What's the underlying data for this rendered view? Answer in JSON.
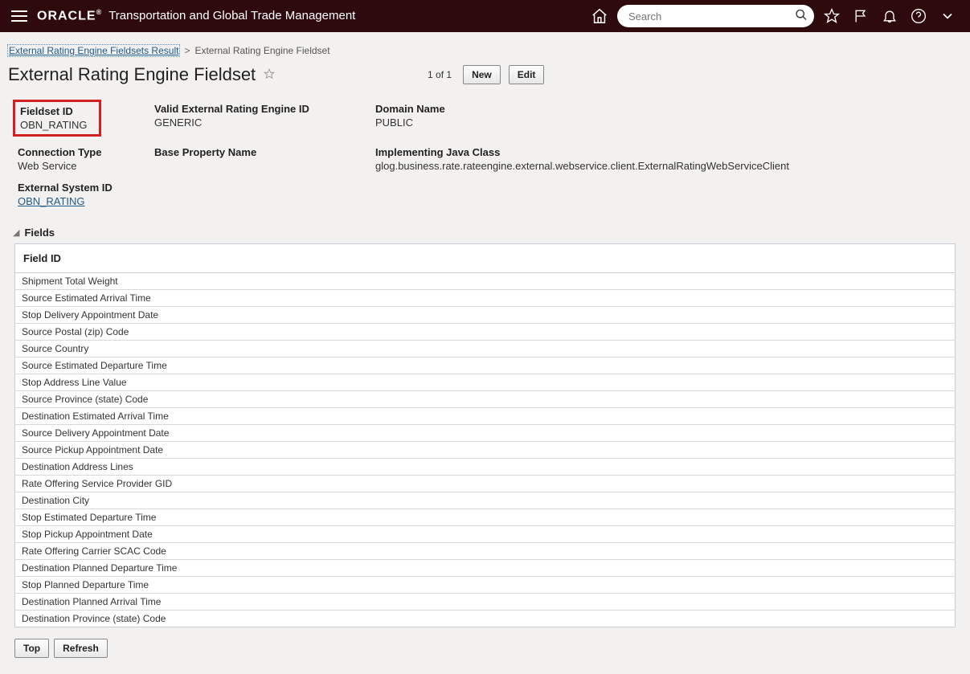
{
  "header": {
    "brand_logo": "ORACLE",
    "brand_title": "Transportation and Global Trade Management",
    "search_placeholder": "Search"
  },
  "breadcrumb": {
    "parent_label": "External Rating Engine Fieldsets Result",
    "separator": ">",
    "current_label": "External Rating Engine Fieldset"
  },
  "page": {
    "title": "External Rating Engine Fieldset",
    "pager": "1 of 1",
    "new_label": "New",
    "edit_label": "Edit"
  },
  "details": {
    "fieldset_id": {
      "label": "Fieldset ID",
      "value": "OBN_RATING"
    },
    "valid_ext_engine_id": {
      "label": "Valid External Rating Engine ID",
      "value": "GENERIC"
    },
    "domain_name": {
      "label": "Domain Name",
      "value": "PUBLIC"
    },
    "connection_type": {
      "label": "Connection Type",
      "value": "Web Service"
    },
    "base_property_name": {
      "label": "Base Property Name",
      "value": ""
    },
    "impl_java_class": {
      "label": "Implementing Java Class",
      "value": "glog.business.rate.rateengine.external.webservice.client.ExternalRatingWebServiceClient"
    },
    "external_system_id": {
      "label": "External System ID",
      "link_text": "OBN_RATING"
    }
  },
  "section": {
    "fields_title": "Fields"
  },
  "fields_table": {
    "header": "Field ID",
    "rows": [
      "Shipment Total Weight",
      "Source Estimated Arrival Time",
      "Stop Delivery Appointment Date",
      "Source Postal (zip) Code",
      "Source Country",
      "Source Estimated Departure Time",
      "Stop Address Line Value",
      "Source Province (state) Code",
      "Destination Estimated Arrival Time",
      "Source Delivery Appointment Date",
      "Source Pickup Appointment Date",
      "Destination Address Lines",
      "Rate Offering Service Provider GID",
      "Destination City",
      "Stop Estimated Departure Time",
      "Stop Pickup Appointment Date",
      "Rate Offering Carrier SCAC Code",
      "Destination Planned Departure Time",
      "Stop Planned Departure Time",
      "Destination Planned Arrival Time",
      "Destination Province (state) Code"
    ]
  },
  "footer": {
    "top_label": "Top",
    "refresh_label": "Refresh"
  }
}
